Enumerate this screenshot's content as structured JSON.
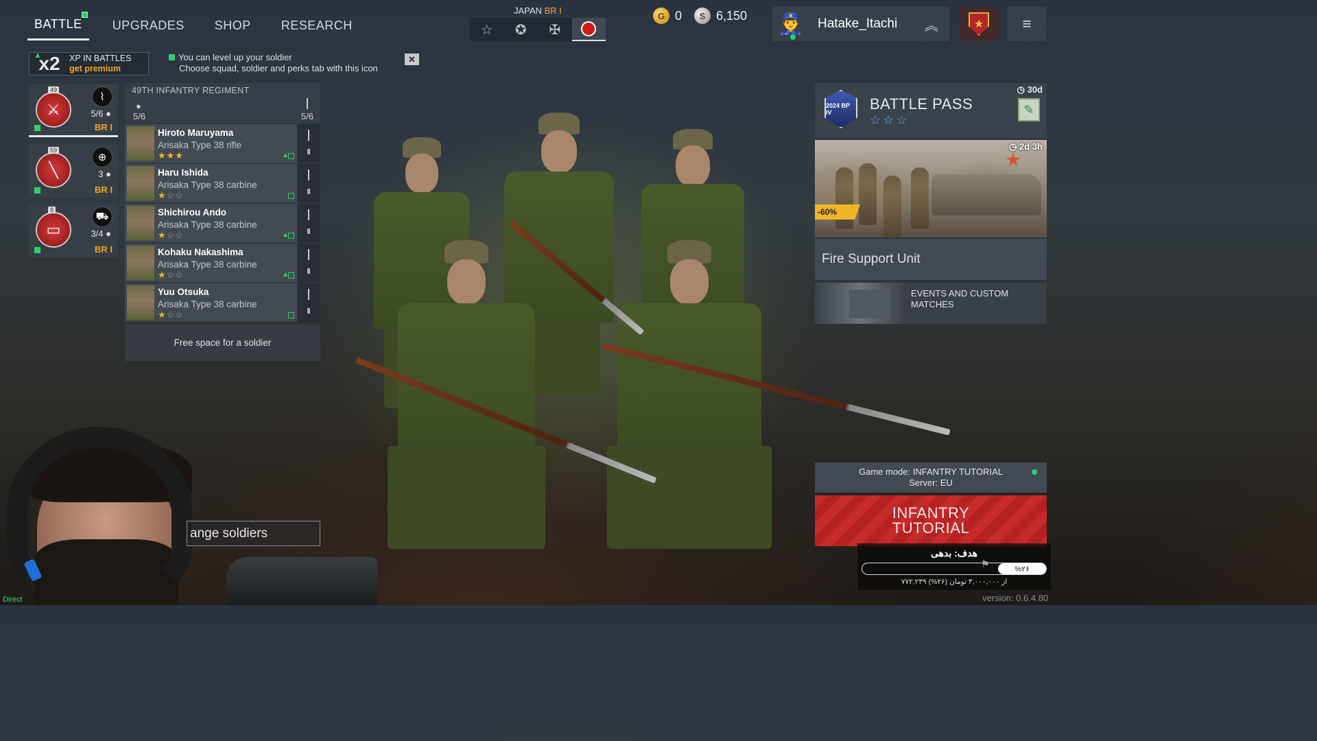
{
  "nav": {
    "tabs": [
      {
        "label": "BATTLE",
        "active": true,
        "new_indicator": true
      },
      {
        "label": "UPGRADES",
        "active": false
      },
      {
        "label": "SHOP",
        "active": false
      },
      {
        "label": "RESEARCH",
        "active": false
      }
    ]
  },
  "faction": {
    "country": "JAPAN",
    "br": "BR I",
    "options": [
      {
        "icon": "star-outline-icon",
        "glyph": "☆"
      },
      {
        "icon": "star-circle-icon",
        "glyph": "✪"
      },
      {
        "icon": "iron-cross-icon",
        "glyph": "✠"
      },
      {
        "icon": "japan-flag-icon",
        "glyph": "",
        "active": true
      }
    ]
  },
  "currency": {
    "gold": "0",
    "silver": "6,150",
    "gold_icon_glyph": "G",
    "silver_icon_glyph": "S"
  },
  "profile": {
    "name": "Hatake_Itachi",
    "avatar_glyph": "👮",
    "rank_glyph": "︽",
    "menu_glyph": "≡",
    "badge_glyph": "★"
  },
  "premium": {
    "multiplier": "x2",
    "line1": "XP IN BATTLES",
    "line2": "get premium"
  },
  "hint": {
    "line1": "You can level up your soldier",
    "line2": "Choose squad, soldier and perks tab with this icon",
    "close_glyph": "✕"
  },
  "squads": [
    {
      "level": "49",
      "emblem_glyph": "⚔",
      "type_glyph": "⌇",
      "count": "5/6",
      "br": "BR I",
      "selected": true
    },
    {
      "level": "59",
      "emblem_glyph": "╲",
      "type_glyph": "⊕",
      "count": "3",
      "br": "BR I",
      "selected": false
    },
    {
      "level": "8",
      "emblem_glyph": "▭",
      "type_glyph": "⛟",
      "count": "3/4",
      "br": "BR I",
      "selected": false
    }
  ],
  "regiment": {
    "name": "49TH INFANTRY REGIMENT",
    "soldiers_count": "5/6",
    "weapons_count": "5/6"
  },
  "soldiers": [
    {
      "name": "Hiroto Maruyama",
      "weapon": "Arisaka Type 38 rifle",
      "stars_on": "★★★",
      "stars_off": "",
      "can_upgrade": true
    },
    {
      "name": "Haru Ishida",
      "weapon": "Arisaka Type 38 carbine",
      "stars_on": "★",
      "stars_off": "☆☆",
      "can_upgrade": false
    },
    {
      "name": "Shichirou Ando",
      "weapon": "Arisaka Type 38 carbine",
      "stars_on": "★",
      "stars_off": "☆☆",
      "can_upgrade": true
    },
    {
      "name": "Kohaku Nakashima",
      "weapon": "Arisaka Type 38 carbine",
      "stars_on": "★",
      "stars_off": "☆☆",
      "can_upgrade": true
    },
    {
      "name": "Yuu Otsuka",
      "weapon": "Arisaka Type 38 carbine",
      "stars_on": "★",
      "stars_off": "☆☆",
      "can_upgrade": false
    }
  ],
  "free_space": "Free space for a soldier",
  "arrange_button": "ange soldiers",
  "battle_pass": {
    "title": "BATTLE PASS",
    "stars": "☆☆☆",
    "timer": "◷ 30d",
    "emblem_text": "2024 BP IV",
    "reward_glyph": "✎"
  },
  "offer": {
    "timer": "◷ 2d 3h",
    "discount": "-60%"
  },
  "fire_support": "Fire Support Unit",
  "events": {
    "line1": "EVENTS AND CUSTOM",
    "line2": "MATCHES"
  },
  "game_mode": {
    "mode": "Game mode: INFANTRY TUTORIAL",
    "server": "Server: EU"
  },
  "play_button": {
    "line1": "INFANTRY",
    "line2": "TUTORIAL"
  },
  "donation": {
    "goal": "هدف: بدهی",
    "percent": "%۲۶",
    "progress": 0.26,
    "amount": "۷۷۲,۲۳۹ از ۳,۰۰۰,۰۰۰ تومان (۲۶%)"
  },
  "overlay_tag": "Direct",
  "version": "version: 0.6.4.80"
}
